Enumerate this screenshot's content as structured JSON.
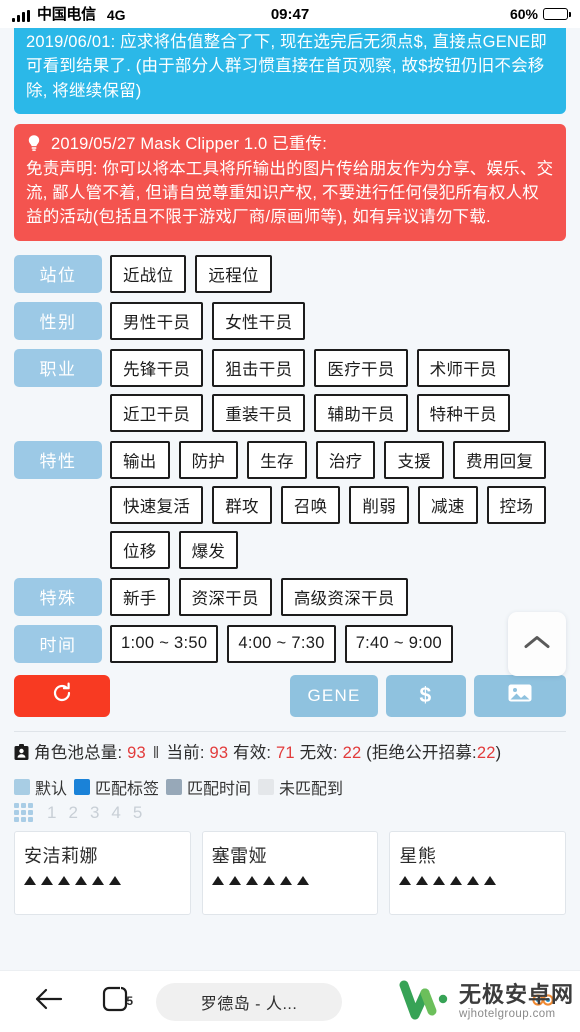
{
  "status_bar": {
    "carrier": "中国电信",
    "network": "4G",
    "time": "09:47",
    "battery_percent": "60%"
  },
  "notices": [
    {
      "id": "notice-update",
      "color": "#2bb8e8",
      "text": "2019/06/01: 应求将估值整合了下, 现在选完后无须点$, 直接点GENE即可看到结果了. (由于部分人群习惯直接在首页观察, 故$按钮仍旧不会移除, 将继续保留)"
    },
    {
      "id": "notice-disclaimer",
      "color": "#f4544f",
      "icon": "lightbulb-icon",
      "title": "2019/05/27 Mask Clipper 1.0 已重传:",
      "text": "免责声明: 你可以将本工具将所输出的图片传给朋友作为分享、娱乐、交流, 鄙人管不着, 但请自觉尊重知识产权, 不要进行任何侵犯所有权人权益的活动(包括且不限于游戏厂商/原画师等), 如有异议请勿下载."
    }
  ],
  "filters": [
    {
      "id": "position",
      "label": "站位",
      "options": [
        "近战位",
        "远程位"
      ]
    },
    {
      "id": "gender",
      "label": "性别",
      "options": [
        "男性干员",
        "女性干员"
      ]
    },
    {
      "id": "profession",
      "label": "职业",
      "options": [
        "先锋干员",
        "狙击干员",
        "医疗干员",
        "术师干员",
        "近卫干员",
        "重装干员",
        "辅助干员",
        "特种干员"
      ]
    },
    {
      "id": "trait",
      "label": "特性",
      "options": [
        "输出",
        "防护",
        "生存",
        "治疗",
        "支援",
        "费用回复",
        "快速复活",
        "群攻",
        "召唤",
        "削弱",
        "减速",
        "控场",
        "位移",
        "爆发"
      ]
    },
    {
      "id": "special",
      "label": "特殊",
      "options": [
        "新手",
        "资深干员",
        "高级资深干员"
      ]
    },
    {
      "id": "time",
      "label": "时间",
      "options": [
        "1:00 ~ 3:50",
        "4:00 ~ 7:30",
        "7:40 ~ 9:00"
      ]
    }
  ],
  "actions": {
    "reset_icon": "refresh-icon",
    "gene_label": "GENE",
    "dollar_label": "$",
    "image_icon": "image-icon"
  },
  "scroll_top": {
    "icon": "chevron-up-icon"
  },
  "stats": {
    "icon": "id-card-icon",
    "pool_label": "角色池总量:",
    "pool_total": "93",
    "separator": "‖",
    "current_label": "当前:",
    "current": "93",
    "valid_label": "有效:",
    "valid": "71",
    "invalid_label": "无效:",
    "invalid": "22",
    "note_prefix": "(拒绝公开招募:",
    "note_value": "22",
    "note_suffix": ")",
    "number_color": "#e23b3b"
  },
  "legend": [
    {
      "label": "默认",
      "color": "#a8cde4"
    },
    {
      "label": "匹配标签",
      "color": "#1a82d8"
    },
    {
      "label": "匹配时间",
      "color": "#97a8b8"
    },
    {
      "label": "未匹配到",
      "color": "#e4e7ea"
    }
  ],
  "rarity": {
    "grid_icon": "grid-icon",
    "levels": [
      "1",
      "2",
      "3",
      "4",
      "5"
    ]
  },
  "characters": [
    {
      "name": "安洁莉娜",
      "stars": 6
    },
    {
      "name": "塞雷娅",
      "stars": 6
    },
    {
      "name": "星熊",
      "stars": 6
    }
  ],
  "navbar": {
    "back_icon": "back-arrow-icon",
    "tabs_icon": "tabs-icon",
    "tab_count": "5",
    "address": "罗德岛 - 人...",
    "profile_icon": "smiley-icon"
  },
  "watermark": {
    "logo": "w-logo-icon",
    "name_cn": "无极安卓网",
    "name_en": "wjhotelgroup.com"
  }
}
